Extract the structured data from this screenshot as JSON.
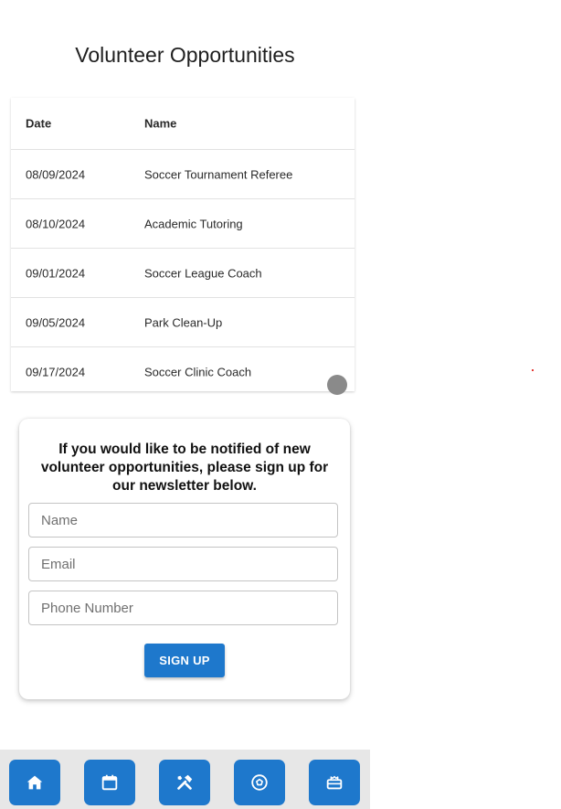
{
  "page": {
    "title": "Volunteer Opportunities"
  },
  "table": {
    "columns": [
      "Date",
      "Name"
    ],
    "rows": [
      {
        "date": "08/09/2024",
        "name": "Soccer Tournament Referee"
      },
      {
        "date": "08/10/2024",
        "name": "Academic Tutoring"
      },
      {
        "date": "09/01/2024",
        "name": "Soccer League Coach"
      },
      {
        "date": "09/05/2024",
        "name": "Park Clean-Up"
      },
      {
        "date": "09/17/2024",
        "name": "Soccer Clinic Coach"
      }
    ]
  },
  "newsletter": {
    "message": "If you would like to be notified of new volunteer opportunities, please sign up for our newsletter below.",
    "name_placeholder": "Name",
    "email_placeholder": "Email",
    "phone_placeholder": "Phone Number",
    "submit_label": "SIGN UP"
  },
  "nav": {
    "items": [
      {
        "icon": "home-icon"
      },
      {
        "icon": "calendar-icon"
      },
      {
        "icon": "tools-icon"
      },
      {
        "icon": "soccer-ball-icon"
      },
      {
        "icon": "ticket-icon"
      }
    ]
  },
  "colors": {
    "accent": "#1e78cc",
    "nav_background": "#e7e7e7",
    "scroll_indicator": "#8a8a8a"
  }
}
